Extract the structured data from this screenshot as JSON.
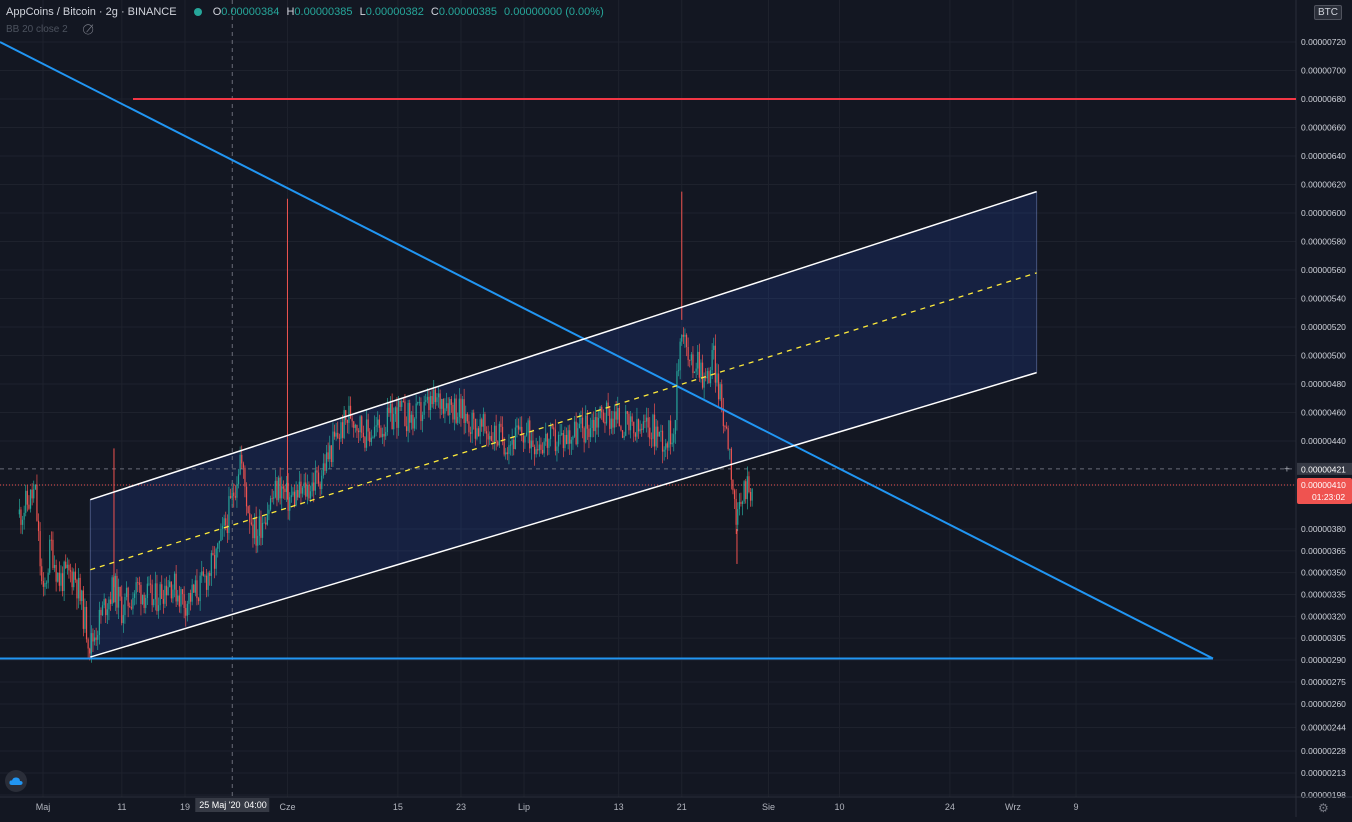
{
  "header": {
    "symbol": "AppCoins / Bitcoin · 2g · BINANCE",
    "ohlc": [
      {
        "k": "O",
        "v": "0.00000384"
      },
      {
        "k": "H",
        "v": "0.00000385"
      },
      {
        "k": "L",
        "v": "0.00000382"
      },
      {
        "k": "C",
        "v": "0.00000385"
      }
    ],
    "change": "0.00000000 (0.00%)",
    "indicator": "BB 20 close 2",
    "currency": "BTC"
  },
  "chart_data": {
    "type": "candlestick",
    "pair": "AppCoins / Bitcoin",
    "interval": "2g",
    "exchange": "BINANCE",
    "y_ticks": [
      "0.00000198",
      "0.00000213",
      "0.00000228",
      "0.00000244",
      "0.00000260",
      "0.00000275",
      "0.00000290",
      "0.00000305",
      "0.00000320",
      "0.00000335",
      "0.00000350",
      "0.00000365",
      "0.00000380",
      "0.00000410",
      "0.00000440",
      "0.00000460",
      "0.00000480",
      "0.00000500",
      "0.00000520",
      "0.00000540",
      "0.00000560",
      "0.00000580",
      "0.00000600",
      "0.00000620",
      "0.00000640",
      "0.00000660",
      "0.00000680",
      "0.00000700",
      "0.00000720"
    ],
    "x_ticks": [
      "Maj",
      "11",
      "19",
      "Cze",
      "15",
      "23",
      "Lip",
      "13",
      "21",
      "Sie",
      "10",
      "24",
      "Wrz",
      "9"
    ],
    "crosshair_price": "0.00000421",
    "crosshair_date": "25 Maj '20",
    "crosshair_time": "04:00",
    "last_price": "0.00000410",
    "countdown": "01:23:02",
    "price_path": [
      [
        "Apr 28",
        3.9e-06
      ],
      [
        "Apr 30",
        4.05e-06
      ],
      [
        "May 1",
        3.3e-06
      ],
      [
        "May 2",
        3.7e-06
      ],
      [
        "May 3",
        3.45e-06
      ],
      [
        "May 5",
        3.5e-06
      ],
      [
        "May 7",
        3e-06
      ],
      [
        "May 9",
        3.3e-06
      ],
      [
        "May 10",
        3.4e-06
      ],
      [
        "May 11",
        3.25e-06
      ],
      [
        "May 13",
        3.4e-06
      ],
      [
        "May 15",
        3.3e-06
      ],
      [
        "May 17",
        3.45e-06
      ],
      [
        "May 19",
        3.3e-06
      ],
      [
        "May 21",
        3.4e-06
      ],
      [
        "May 23",
        3.6e-06
      ],
      [
        "May 25",
        4e-06
      ],
      [
        "May 26",
        4.3e-06
      ],
      [
        "May 27",
        3.95e-06
      ],
      [
        "May 28",
        3.75e-06
      ],
      [
        "May 29",
        3.9e-06
      ],
      [
        "May 31",
        4.1e-06
      ],
      [
        "Jun 1",
        4e-06
      ],
      [
        "Jun 3",
        4.05e-06
      ],
      [
        "Jun 5",
        4.15e-06
      ],
      [
        "Jun 7",
        4.4e-06
      ],
      [
        "Jun 9",
        4.6e-06
      ],
      [
        "Jun 11",
        4.45e-06
      ],
      [
        "Jun 13",
        4.5e-06
      ],
      [
        "Jun 15",
        4.6e-06
      ],
      [
        "Jun 17",
        4.55e-06
      ],
      [
        "Jun 19",
        4.65e-06
      ],
      [
        "Jun 21",
        4.7e-06
      ],
      [
        "Jun 23",
        4.6e-06
      ],
      [
        "Jun 25",
        4.5e-06
      ],
      [
        "Jun 27",
        4.45e-06
      ],
      [
        "Jun 29",
        4.4e-06
      ],
      [
        "Jul 1",
        4.45e-06
      ],
      [
        "Jul 3",
        4.4e-06
      ],
      [
        "Jul 5",
        4.4e-06
      ],
      [
        "Jul 7",
        4.45e-06
      ],
      [
        "Jul 9",
        4.5e-06
      ],
      [
        "Jul 11",
        4.6e-06
      ],
      [
        "Jul 13",
        4.55e-06
      ],
      [
        "Jul 15",
        4.45e-06
      ],
      [
        "Jul 17",
        4.5e-06
      ],
      [
        "Jul 19",
        4.4e-06
      ],
      [
        "Jul 20",
        4.5e-06
      ],
      [
        "Jul 21",
        5.25e-06
      ],
      [
        "Jul 22",
        4.9e-06
      ],
      [
        "Jul 23",
        5e-06
      ],
      [
        "Jul 24",
        4.8e-06
      ],
      [
        "Jul 25",
        5e-06
      ],
      [
        "Jul 26",
        4.65e-06
      ],
      [
        "Jul 27",
        4.4e-06
      ],
      [
        "Jul 28",
        3.8e-06
      ],
      [
        "Jul 29",
        4.1e-06
      ],
      [
        "Jul 30",
        4.1e-06
      ]
    ],
    "spikes": [
      [
        "May 10",
        4.35e-06
      ],
      [
        "Jun 1",
        6.1e-06
      ],
      [
        "Jul 21",
        6.15e-06
      ],
      [
        "Jul 28",
        3.56e-06
      ]
    ],
    "drawings": {
      "horizontal_resistance": 6.8e-06,
      "horizontal_support": 2.91e-06,
      "descending_trendline": [
        [
          "Apr 26",
          7.3e-06
        ],
        [
          "Sep 26",
          2.91e-06
        ]
      ],
      "channel_upper": [
        [
          "May 7",
          4e-06
        ],
        [
          "Sep 4",
          6.15e-06
        ]
      ],
      "channel_mid": [
        [
          "May 7",
          3.52e-06
        ],
        [
          "Sep 4",
          5.58e-06
        ]
      ],
      "channel_lower": [
        [
          "May 7",
          2.92e-06
        ],
        [
          "Sep 4",
          4.88e-06
        ]
      ]
    },
    "colors": {
      "up": "#26a69a",
      "down": "#ef5350",
      "trendline": "#2196f3",
      "resistance": "#f23645",
      "channel": "#ffffff",
      "midline": "#ffeb3b"
    },
    "grid": true
  }
}
